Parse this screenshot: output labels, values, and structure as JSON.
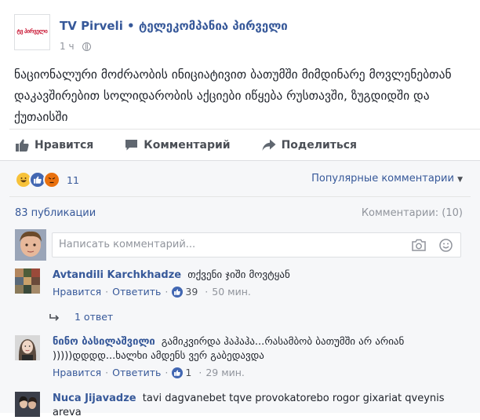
{
  "post": {
    "page_name": "TV Pirveli • ტელეკომპანია პირველი",
    "logo_text": "ტვ პირველი",
    "time": "1 ч",
    "body": "ნაციონალური მოძრაობის ინიციატივით ბათუმში მიმდინარე მოვლენებთან დაკავშირებით სოლიდარობის აქციები იწყება რუსთავში, ზუგდიდში და ქუთაისში"
  },
  "actions": {
    "like": "Нравится",
    "comment": "Комментарий",
    "share": "Поделиться"
  },
  "reactions": {
    "count": "11",
    "icons": [
      "haha-icon",
      "like-icon",
      "angry-icon"
    ],
    "sort_label": "Популярные комментарии"
  },
  "stats": {
    "publications": "83 публикации",
    "comments": "Комментарии: (10)"
  },
  "composer": {
    "placeholder": "Написать комментарий..."
  },
  "comments": [
    {
      "author": "Avtandili Karchkhadze",
      "text": "თქვენი ჯიში მოვტყან",
      "like": "Нравится",
      "reply": "Ответить",
      "likes": "39",
      "time": "50 мин.",
      "replies": "1 ответ"
    },
    {
      "author": "ნინო ბასილაშვილი",
      "text": "გამიკვირდა ჰაჰაჰა...რასამბობ ბათუმში არ არიან )))))დდდდ...ხალხი ამდენს ვერ გაბედავდა",
      "like": "Нравится",
      "reply": "Ответить",
      "likes": "1",
      "time": "29 мин."
    },
    {
      "author": "Nuca Jijavadze",
      "text": "tavi dagvanebet tqve provokatorebo rogor gixariat qveynis areva"
    }
  ],
  "colors": {
    "link": "#365899",
    "like_blue": "#4267b2",
    "muted": "#90949c",
    "background": "#f6f7f9"
  }
}
